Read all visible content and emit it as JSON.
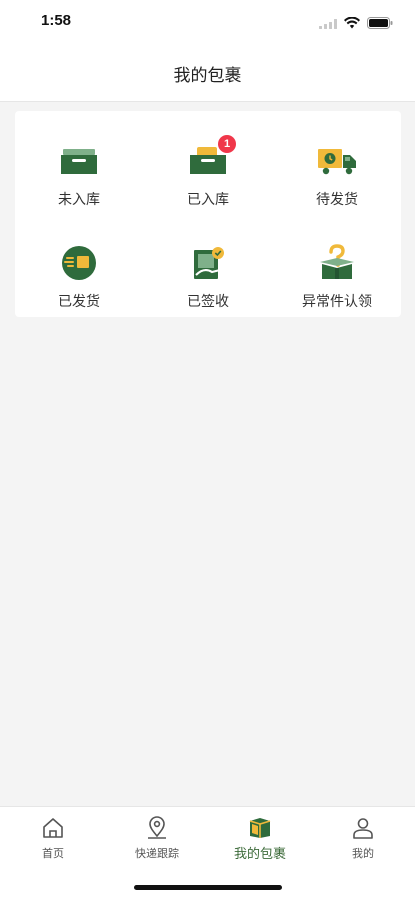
{
  "status_bar": {
    "time": "1:58"
  },
  "nav": {
    "title": "我的包裹"
  },
  "grid": [
    {
      "label": "未入库",
      "icon": "inbox-tray-icon"
    },
    {
      "label": "已入库",
      "icon": "stored-tray-icon",
      "badge": "1"
    },
    {
      "label": "待发货",
      "icon": "delivery-truck-icon"
    },
    {
      "label": "已发货",
      "icon": "shipped-fast-icon"
    },
    {
      "label": "已签收",
      "icon": "signed-receipt-icon"
    },
    {
      "label": "异常件认领",
      "icon": "question-box-icon"
    }
  ],
  "tabs": [
    {
      "label": "首页",
      "icon": "home-icon"
    },
    {
      "label": "快递跟踪",
      "icon": "location-pin-icon"
    },
    {
      "label": "我的包裹",
      "icon": "package-icon",
      "active": true
    },
    {
      "label": "我的",
      "icon": "user-icon"
    }
  ],
  "colors": {
    "brand_green": "#2f6b3c",
    "accent_yellow": "#f0b93a",
    "badge_red": "#f0374a",
    "active_tab_text": "#3d6b3a"
  }
}
